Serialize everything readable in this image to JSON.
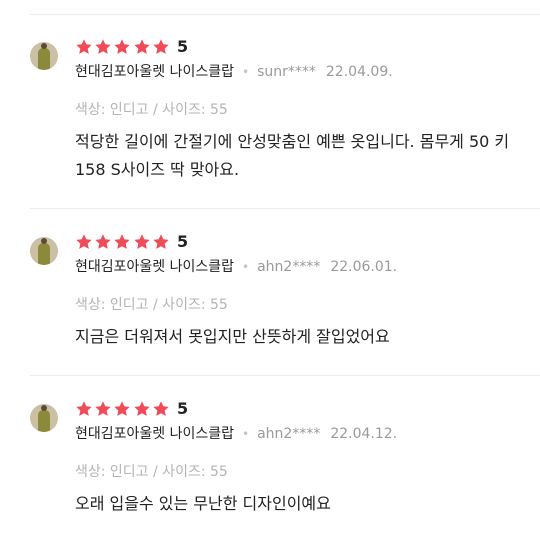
{
  "colors": {
    "star": "#f04b58",
    "muted": "#9a9a9a",
    "divider": "#ececec"
  },
  "reviews": [
    {
      "rating": 5,
      "rating_label": "5",
      "store": "현대김포아울렛 나이스클랍",
      "user": "sunr****",
      "date": "22.04.09.",
      "option": "색상: 인디고 / 사이즈: 55",
      "content": "적당한 길이에 간절기에 안성맞춤인 예쁜 옷입니다. 몸무게 50 키 158 S사이즈 딱 맞아요."
    },
    {
      "rating": 5,
      "rating_label": "5",
      "store": "현대김포아울렛 나이스클랍",
      "user": "ahn2****",
      "date": "22.06.01.",
      "option": "색상: 인디고 / 사이즈: 55",
      "content": "지금은 더워져서 못입지만  산뜻하게 잘입었어요"
    },
    {
      "rating": 5,
      "rating_label": "5",
      "store": "현대김포아울렛 나이스클랍",
      "user": "ahn2****",
      "date": "22.04.12.",
      "option": "색상: 인디고 / 사이즈: 55",
      "content": "오래 입을수 있는 무난한 디자인이예요"
    }
  ]
}
